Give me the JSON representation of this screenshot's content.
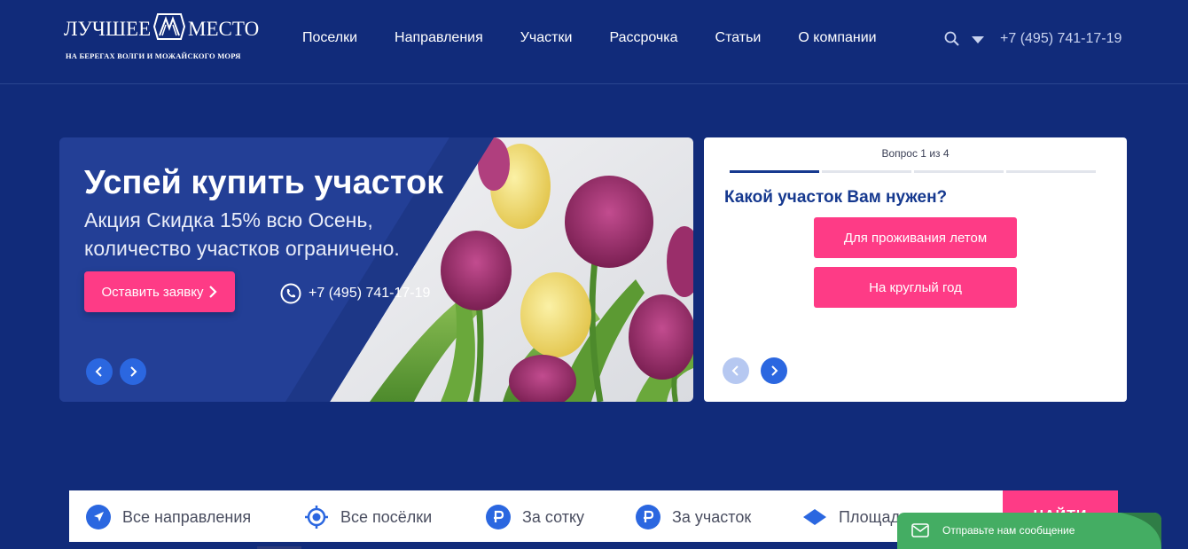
{
  "header": {
    "logo_left": "ЛУЧШЕЕ",
    "logo_right": "МЕСТО",
    "logo_sub": "НА БЕРЕГАХ ВОЛГИ И МОЖАЙСКОГО МОРЯ",
    "nav": [
      "Поселки",
      "Направления",
      "Участки",
      "Рассрочка",
      "Статьи",
      "О компании"
    ],
    "phone": "+7 (495) 741-17-19"
  },
  "promo": {
    "title": "Успей купить участок",
    "text": "Акция Скидка 15% всю Осень, количество участков ограничено.",
    "cta": "Оставить заявку",
    "phone": "+7 (495) 741-17-19"
  },
  "quiz": {
    "counter": "Вопрос 1 из 4",
    "question": "Какой участок Вам нужен?",
    "options": [
      "Для проживания летом",
      "На круглый год"
    ],
    "step": 1,
    "steps": 4
  },
  "filter": {
    "items": [
      "Все направления",
      "Все посёлки",
      "За сотку",
      "За участок",
      "Площадь"
    ],
    "find": "НАЙТИ"
  },
  "chat": {
    "label": "Отправьте нам сообщение"
  },
  "colors": {
    "background": "#112b7a",
    "accent": "#fe3b86",
    "blue_button": "#2b67e0",
    "chat_green": "#44ad63"
  }
}
